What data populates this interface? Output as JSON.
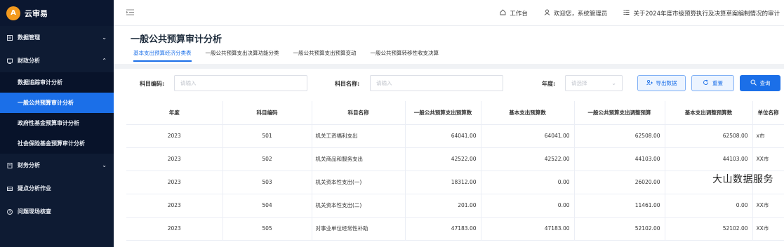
{
  "app": {
    "logo_char": "A",
    "title": "云审易"
  },
  "sidebar": {
    "items": [
      {
        "label": "数据管理",
        "chevron": "⌄"
      },
      {
        "label": "财政分析",
        "chevron": "⌃"
      }
    ],
    "sub_items": [
      {
        "label": "数据追踪审计分析"
      },
      {
        "label": "一般公共预算审计分析"
      },
      {
        "label": "政府性基金预算审计分析"
      },
      {
        "label": "社会保险基金预算审计分析"
      }
    ],
    "items_after": [
      {
        "label": "财务分析",
        "chevron": "⌄"
      },
      {
        "label": "疑点分析作业"
      },
      {
        "label": "问题现场核查"
      }
    ]
  },
  "topbar": {
    "workbench": "工作台",
    "welcome": "欢迎您，系统管理员",
    "project": "关于2024年度市级预算执行及决算草案编制情况的审计"
  },
  "page": {
    "title": "一般公共预算审计分析",
    "tabs": [
      "基本支出预算经济分类表",
      "一般公共预算支出决算功能分类",
      "一般公共预算支出预算变动",
      "一般公共预算转移性收支决算"
    ]
  },
  "filter": {
    "code_label": "科目编码:",
    "code_placeholder": "请输入",
    "name_label": "科目名称:",
    "name_placeholder": "请输入",
    "year_label": "年度:",
    "year_placeholder": "请选择",
    "export_label": "导出数据",
    "reset_label": "重置",
    "search_label": "查询"
  },
  "table": {
    "headers": [
      "年度",
      "科目编码",
      "科目名称",
      "一般公共预算支出预算数",
      "基本支出预算数",
      "一般公共预算支出调整预算",
      "基本支出调整预算数",
      "单位名称"
    ],
    "rows": [
      [
        "2023",
        "501",
        "机关工资福利支出",
        "64041.00",
        "64041.00",
        "62508.00",
        "62508.00",
        "x市"
      ],
      [
        "2023",
        "502",
        "机关商品和服务支出",
        "42522.00",
        "42522.00",
        "44103.00",
        "44103.00",
        "XX市"
      ],
      [
        "2023",
        "503",
        "机关资本性支出(一)",
        "18312.00",
        "0.00",
        "26020.00",
        "",
        ""
      ],
      [
        "2023",
        "504",
        "机关资本性支出(二)",
        "201.00",
        "0.00",
        "11461.00",
        "0.00",
        "XX市"
      ],
      [
        "2023",
        "505",
        "对事业单位经常性补助",
        "47183.00",
        "47183.00",
        "52102.00",
        "52102.00",
        "XX市"
      ]
    ]
  },
  "watermark": "大山数据服务"
}
